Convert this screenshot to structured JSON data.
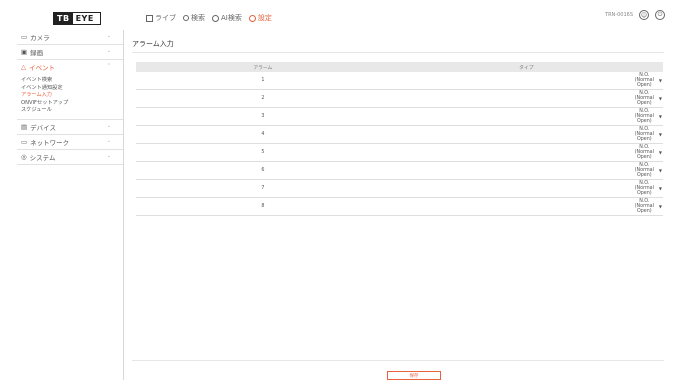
{
  "brand": {
    "part1": "TB",
    "part2": "EYE"
  },
  "topnav": [
    {
      "icon": "monitor-icon",
      "label": "ライブ",
      "active": false
    },
    {
      "icon": "search-icon",
      "label": "検索",
      "active": false
    },
    {
      "icon": "ai-search-icon",
      "label": "AI検索",
      "active": false
    },
    {
      "icon": "gear-icon",
      "label": "設定",
      "active": true
    }
  ],
  "topright": {
    "device": "TRN-0016S"
  },
  "sidebar": {
    "camera": "カメラ",
    "record": "録画",
    "event": "イベント",
    "event_items": [
      "イベント検索",
      "イベント通知設定",
      "アラーム入力",
      "ONVIFセットアップ",
      "スケジュール"
    ],
    "device": "デバイス",
    "network": "ネットワーク",
    "system": "システム"
  },
  "page_title": "アラーム入力",
  "table": {
    "headers": [
      "アラーム",
      "タイプ"
    ],
    "rows": [
      {
        "no": "1",
        "type": "N.O. (Normal Open)"
      },
      {
        "no": "2",
        "type": "N.O. (Normal Open)"
      },
      {
        "no": "3",
        "type": "N.O. (Normal Open)"
      },
      {
        "no": "4",
        "type": "N.O. (Normal Open)"
      },
      {
        "no": "5",
        "type": "N.O. (Normal Open)"
      },
      {
        "no": "6",
        "type": "N.O. (Normal Open)"
      },
      {
        "no": "7",
        "type": "N.O. (Normal Open)"
      },
      {
        "no": "8",
        "type": "N.O. (Normal Open)"
      }
    ]
  },
  "save_label": "保存",
  "colors": {
    "accent": "#e8623e"
  }
}
